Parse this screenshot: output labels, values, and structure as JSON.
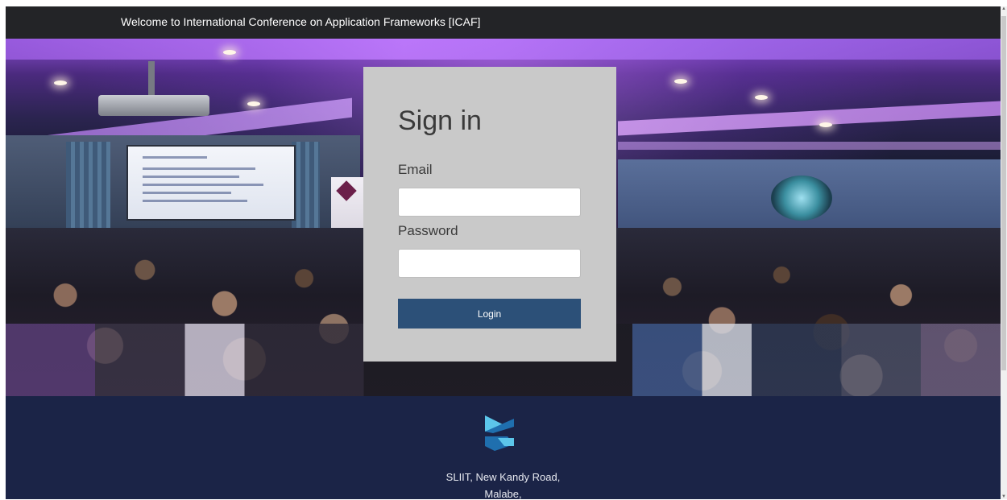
{
  "navbar": {
    "title": "Welcome to International Conference on Application Frameworks [ICAF]"
  },
  "hero": {
    "background_image": "conference audience photo"
  },
  "login": {
    "title": "Sign in",
    "email_label": "Email",
    "email_value": "",
    "password_label": "Password",
    "password_value": "",
    "button_label": "Login"
  },
  "footer": {
    "logo_icon": "sliit-logo-icon",
    "address_line1": "SLIIT, New Kandy Road,",
    "address_line2": "Malabe,"
  },
  "colors": {
    "navbar_bg": "#232427",
    "card_bg": "#c9c9c9",
    "button_bg": "#2c5078",
    "footer_bg": "#1b2447",
    "logo_dark": "#1f6fae",
    "logo_light": "#5cc6ea"
  },
  "scrollbar": {
    "up_icon": "▲",
    "down_icon": "▼"
  }
}
